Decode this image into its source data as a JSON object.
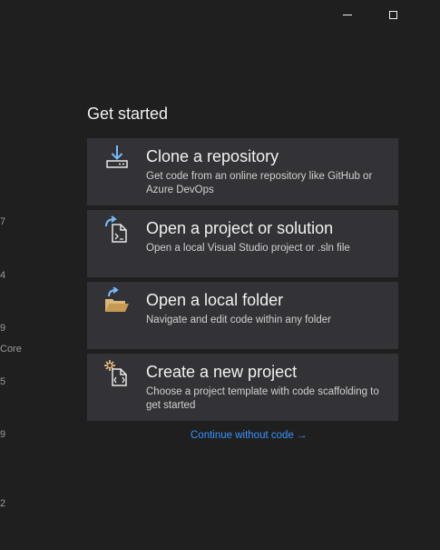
{
  "window_controls": {
    "minimize": "minimize",
    "maximize": "maximize"
  },
  "left_edge_fragments": [
    "7",
    "4",
    "9",
    "Core",
    "5",
    "9",
    "2"
  ],
  "get_started": {
    "heading": "Get started",
    "cards": [
      {
        "title": "Clone a repository",
        "description": "Get code from an online repository like GitHub or Azure DevOps",
        "icon": "download-clone-icon"
      },
      {
        "title": "Open a project or solution",
        "description": "Open a local Visual Studio project or .sln file",
        "icon": "open-project-icon"
      },
      {
        "title": "Open a local folder",
        "description": "Navigate and edit code within any folder",
        "icon": "open-folder-icon"
      },
      {
        "title": "Create a new project",
        "description": "Choose a project template with code scaffolding to get started",
        "icon": "new-project-icon"
      }
    ],
    "continue_link": "Continue without code",
    "continue_arrow": "→"
  },
  "colors": {
    "background": "#1f1f1f",
    "card": "#333337",
    "link": "#3794ff",
    "icon_blue": "#75beff",
    "icon_folder": "#dcb67a"
  }
}
